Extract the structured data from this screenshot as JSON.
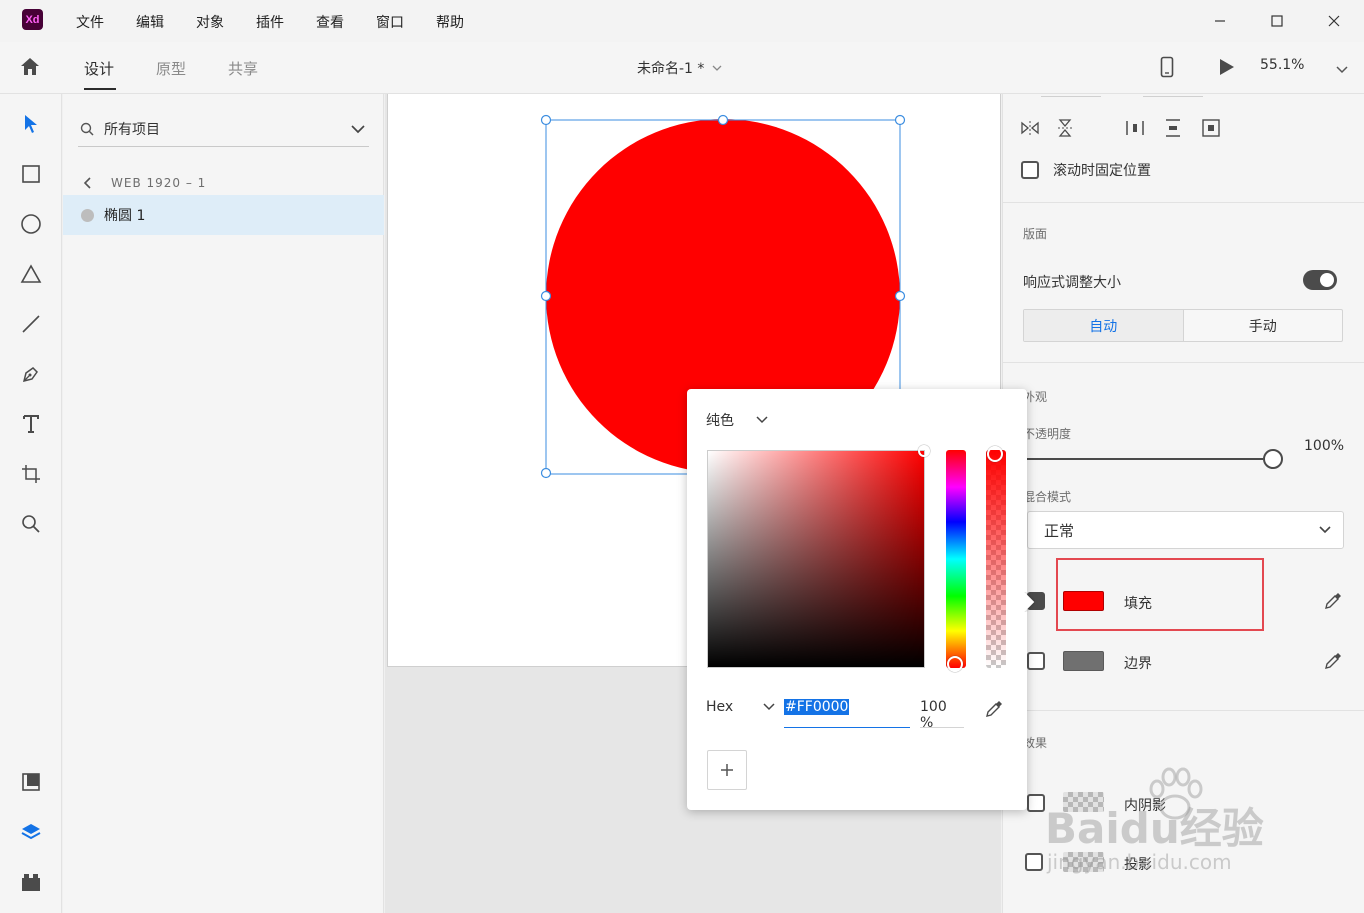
{
  "app": {
    "logo_text": "Xd"
  },
  "menu": [
    "文件",
    "编辑",
    "对象",
    "插件",
    "查看",
    "窗口",
    "帮助"
  ],
  "toolbar": {
    "tabs": [
      "设计",
      "原型",
      "共享"
    ],
    "doc_title": "未命名-1 *",
    "zoom": "55.1%"
  },
  "layers": {
    "search_placeholder": "所有项目",
    "artboard_name": "WEB 1920 – 1",
    "items": [
      {
        "label": "椭圆 1"
      }
    ]
  },
  "props": {
    "fix_on_scroll": "滚动时固定位置",
    "layout_header": "版面",
    "responsive_resize": "响应式调整大小",
    "auto_label": "自动",
    "manual_label": "手动",
    "appearance_header": "外观",
    "opacity_label": "不透明度",
    "opacity_value": "100%",
    "blend_label": "混合模式",
    "blend_value": "正常",
    "fill_label": "填充",
    "border_label": "边界",
    "effects_header": "效果",
    "inner_shadow_label": "内阴影",
    "drop_shadow_label": "投影"
  },
  "picker": {
    "mode": "纯色",
    "format": "Hex",
    "hex_value": "#FF0000",
    "alpha_value": "100 %"
  },
  "watermark": {
    "line1": "Baidu经验",
    "line2": "jingyan.baidu.com"
  },
  "colors": {
    "accent": "#1473e6",
    "fill": "#ff0000",
    "border": "#707070",
    "highlight": "#e34850"
  }
}
